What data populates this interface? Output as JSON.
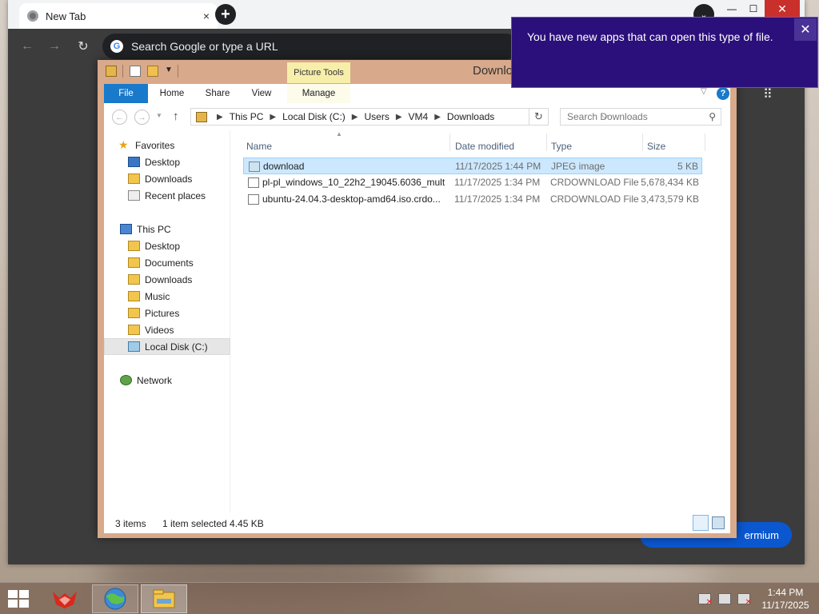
{
  "browser": {
    "tab_title": "New Tab",
    "tab_close": "×",
    "new_tab": "+",
    "tab_search": "⌄",
    "omnibox_placeholder": "Search Google or type a URL",
    "google_letter": "G",
    "premium_label": "ermium",
    "window_controls": {
      "minimize": "—",
      "maximize": "☐",
      "close": "✕"
    }
  },
  "explorer": {
    "title": "Downlo",
    "contextual_tab_group": "Picture Tools",
    "ribbon_tabs": [
      "File",
      "Home",
      "Share",
      "View",
      "Manage"
    ],
    "breadcrumb": [
      "This PC",
      "Local Disk (C:)",
      "Users",
      "VM4",
      "Downloads"
    ],
    "search_placeholder": "Search Downloads",
    "columns": {
      "name": "Name",
      "date": "Date modified",
      "type": "Type",
      "size": "Size"
    },
    "nav": {
      "favorites": "Favorites",
      "fav_desktop": "Desktop",
      "fav_downloads": "Downloads",
      "fav_recent": "Recent places",
      "this_pc": "This PC",
      "pc_desktop": "Desktop",
      "pc_documents": "Documents",
      "pc_downloads": "Downloads",
      "pc_music": "Music",
      "pc_pictures": "Pictures",
      "pc_videos": "Videos",
      "pc_localdisk": "Local Disk (C:)",
      "network": "Network"
    },
    "files": [
      {
        "name": "download",
        "date": "11/17/2025 1:44 PM",
        "type": "JPEG image",
        "size": "5 KB",
        "selected": true
      },
      {
        "name": "pl-pl_windows_10_22h2_19045.6036_mult...",
        "date": "11/17/2025 1:34 PM",
        "type": "CRDOWNLOAD File",
        "size": "5,678,434 KB",
        "selected": false
      },
      {
        "name": "ubuntu-24.04.3-desktop-amd64.iso.crdo...",
        "date": "11/17/2025 1:34 PM",
        "type": "CRDOWNLOAD File",
        "size": "3,473,579 KB",
        "selected": false
      }
    ],
    "status": {
      "item_count": "3 items",
      "selection": "1 item selected  4.45 KB"
    }
  },
  "toast": {
    "message": "You have new apps that can open this type of file.",
    "close": "✕"
  },
  "taskbar": {
    "clock_time": "1:44 PM",
    "clock_date": "11/17/2025"
  },
  "colors": {
    "explorer_frame": "#d8a98a",
    "file_tab": "#1979ca",
    "toast_bg": "#2b0f7a",
    "selection": "#cce8ff",
    "premium_button": "#0b57d0"
  }
}
